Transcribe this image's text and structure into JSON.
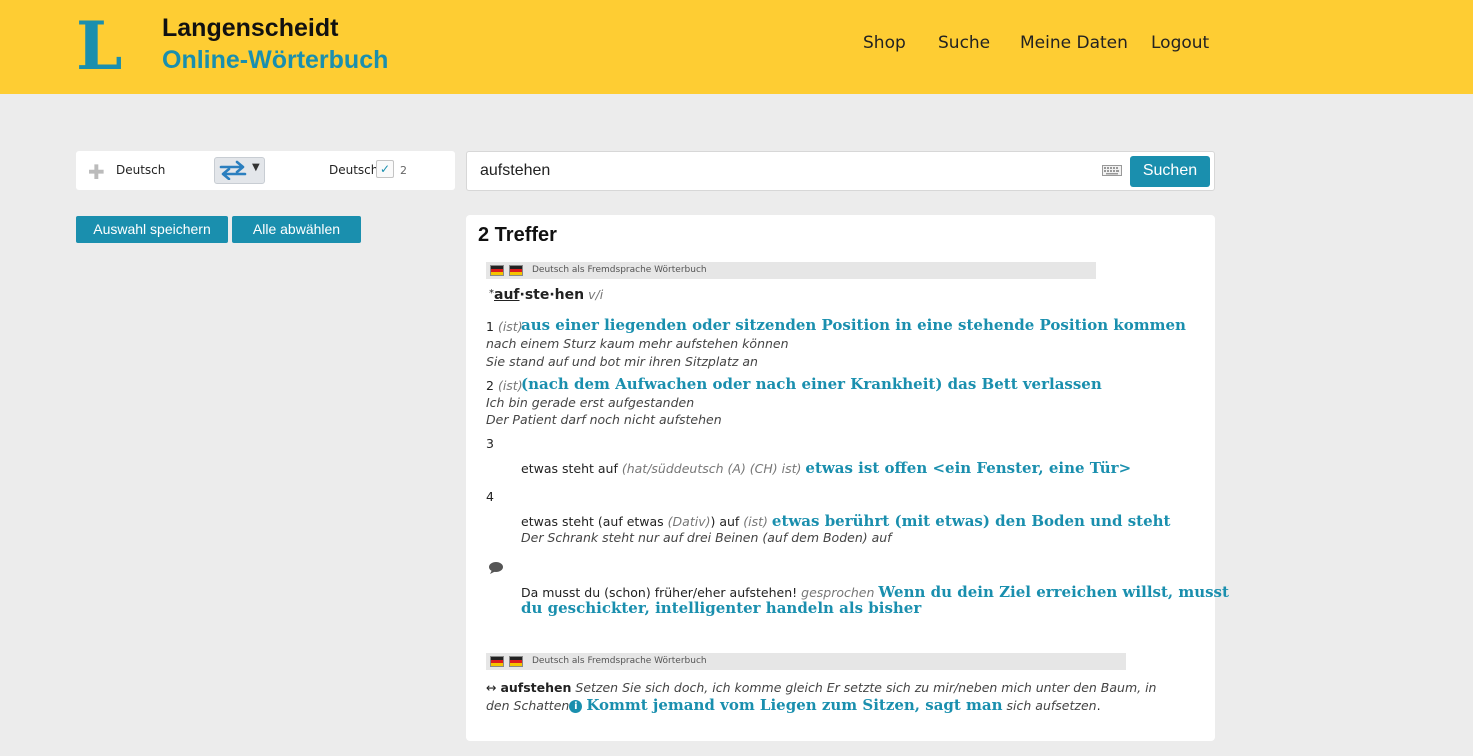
{
  "header": {
    "logo_mark": "L",
    "brand": "Langenscheidt",
    "product": "Online-Wörterbuch",
    "nav": [
      "Shop",
      "Suche",
      "Meine Daten",
      "Logout"
    ]
  },
  "languages": {
    "source": "Deutsch",
    "target": "Deutsch",
    "dict_count": "2",
    "swap_icon": "swap-arrows-icon"
  },
  "search": {
    "query": "aufstehen",
    "button": "Suchen",
    "keyboard_icon": "keyboard-icon"
  },
  "actions": {
    "save_selection": "Auswahl speichern",
    "deselect_all": "Alle abwählen"
  },
  "colors": {
    "header_bg": "#fecd33",
    "accent": "#1a8fae",
    "page_bg": "#ececec"
  },
  "results": {
    "title": "2 Treffer",
    "entry1": {
      "source": "Deutsch als Fremdsprache Wörterbuch",
      "headword_mark": "*",
      "headword_stressed": "auf",
      "headword_rest": "·ste·hen",
      "pos": "v/i",
      "senses": [
        {
          "num": "1",
          "gram": "(ist)",
          "def": "aus einer liegenden oder sitzenden Position in eine stehende Position kommen",
          "examples": [
            "nach einem Sturz kaum mehr aufstehen können",
            "Sie stand auf und bot mir ihren Sitzplatz an"
          ]
        },
        {
          "num": "2",
          "gram": "(ist)",
          "def": "(nach dem Aufwachen oder nach einer Krankheit) das Bett verlassen",
          "examples": [
            "Ich bin gerade erst aufgestanden",
            "Der Patient darf noch nicht aufstehen"
          ]
        },
        {
          "num": "3",
          "phrase": "etwas steht auf",
          "gram": "(hat/süddeutsch (A) (CH) ist)",
          "def": "etwas ist offen <ein Fenster, eine Tür>"
        },
        {
          "num": "4",
          "phrase_a": "etwas steht (auf etwas ",
          "phrase_gram": "(Dativ)",
          "phrase_b": ") auf",
          "gram": "(ist)",
          "def": "etwas berührt (mit etwas) den Boden und steht",
          "example": "Der Schrank steht nur auf drei Beinen (auf dem Boden) auf"
        }
      ],
      "idiom": {
        "icon": "speech-bubble-icon",
        "phrase": "Da musst du (schon) früher/eher aufstehen!",
        "register": "gesprochen",
        "def_line1": "Wenn du dein Ziel erreichen willst, musst",
        "def_line2": "du geschickter, intelligenter handeln als bisher"
      }
    },
    "entry2": {
      "source": "Deutsch als Fremdsprache Wörterbuch",
      "arrow": "↔",
      "headword": "aufstehen",
      "example_line1": "Setzen Sie sich doch, ich komme gleich Er setzte sich zu mir/neben mich unter den Baum, in",
      "example_line2": "den Schatten",
      "info_icon": "info-icon",
      "def": "Kommt jemand vom Liegen zum Sitzen, sagt man",
      "note": "sich aufsetzen",
      "end": "."
    }
  }
}
